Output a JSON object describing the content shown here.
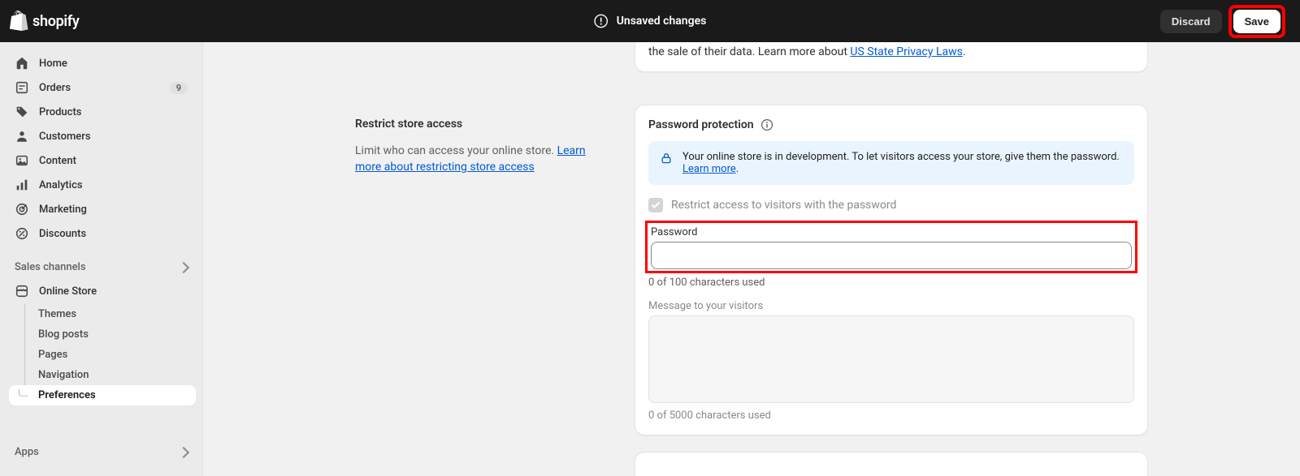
{
  "brand": "shopify",
  "topbar": {
    "unsaved_label": "Unsaved changes",
    "discard_label": "Discard",
    "save_label": "Save"
  },
  "sidebar": {
    "items": [
      {
        "label": "Home"
      },
      {
        "label": "Orders",
        "badge": "9"
      },
      {
        "label": "Products"
      },
      {
        "label": "Customers"
      },
      {
        "label": "Content"
      },
      {
        "label": "Analytics"
      },
      {
        "label": "Marketing"
      },
      {
        "label": "Discounts"
      }
    ],
    "sales_channels_title": "Sales channels",
    "online_store_label": "Online Store",
    "sub_items": [
      {
        "label": "Themes"
      },
      {
        "label": "Blog posts"
      },
      {
        "label": "Pages"
      },
      {
        "label": "Navigation"
      },
      {
        "label": "Preferences"
      }
    ],
    "apps_label": "Apps"
  },
  "partial_card": {
    "text_prefix": "the sale of their data. Learn more about ",
    "link_text": "US State Privacy Laws",
    "text_suffix": "."
  },
  "restrict": {
    "title": "Restrict store access",
    "desc_prefix": "Limit who can access your online store. ",
    "link_text": "Learn more about restricting store access"
  },
  "password_card": {
    "header": "Password protection",
    "banner_text": "Your online store is in development. To let visitors access your store, give them the password. ",
    "banner_link": "Learn more",
    "banner_suffix": ".",
    "checkbox_label": "Restrict access to visitors with the password",
    "password_label": "Password",
    "password_value": "",
    "password_count": "0 of 100 characters used",
    "message_label": "Message to your visitors",
    "message_value": "",
    "message_count": "0 of 5000 characters used"
  }
}
